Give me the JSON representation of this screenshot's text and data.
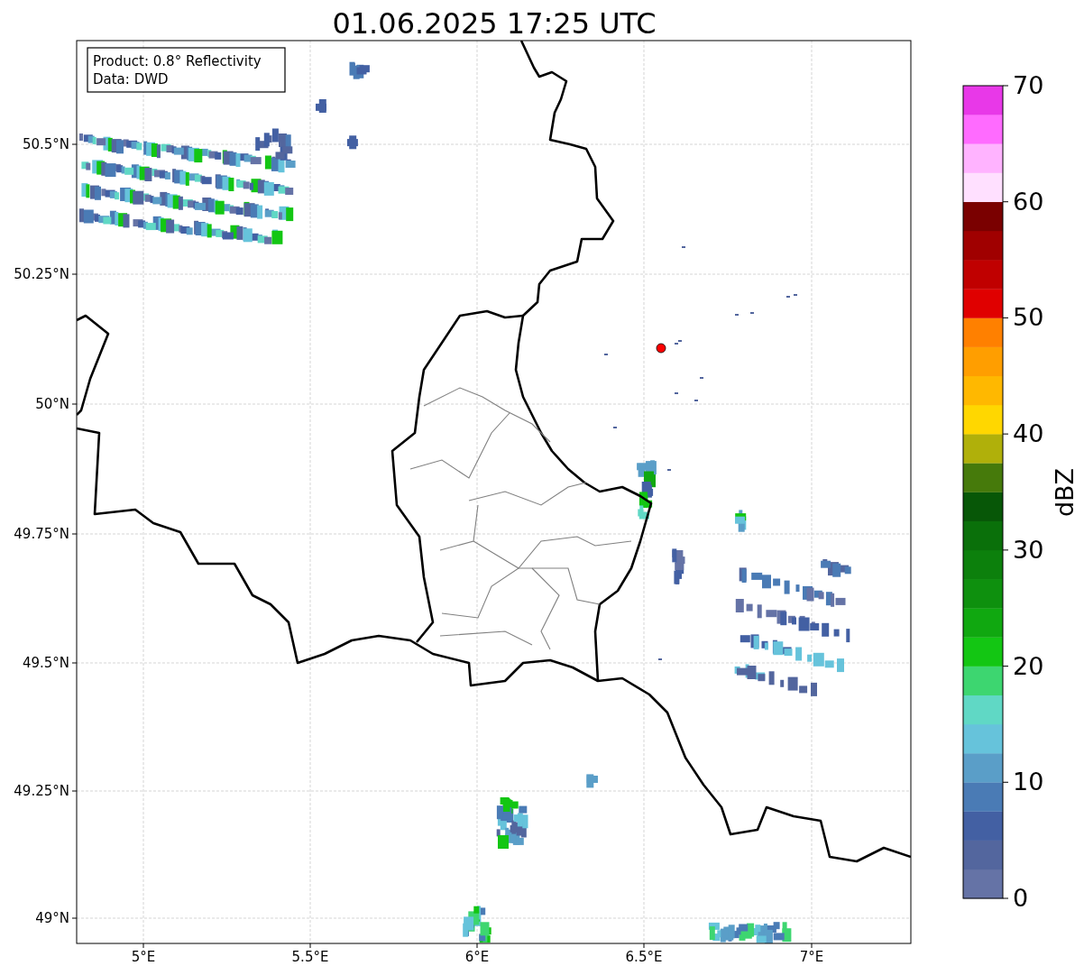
{
  "title": "01.06.2025 17:25 UTC",
  "legend": [
    "Product: 0.8° Reflectivity",
    "Data: DWD"
  ],
  "map": {
    "lon_ticks": [
      "5°E",
      "5.5°E",
      "6°E",
      "6.5°E",
      "7°E"
    ],
    "lat_ticks": [
      "50.5°N",
      "50.25°N",
      "50°N",
      "49.75°N",
      "49.5°N",
      "49.25°N",
      "49°N"
    ]
  },
  "colorbar": {
    "label": "dBZ",
    "ticks": [
      "70",
      "60",
      "50",
      "40",
      "30",
      "20",
      "10",
      "0"
    ],
    "segments": [
      {
        "color": "#6573a6"
      },
      {
        "color": "#53669e"
      },
      {
        "color": "#4360a3"
      },
      {
        "color": "#4a7bb5"
      },
      {
        "color": "#5a9ec8"
      },
      {
        "color": "#66c3db"
      },
      {
        "color": "#60d8c5"
      },
      {
        "color": "#3dd670"
      },
      {
        "color": "#13c613"
      },
      {
        "color": "#10a810"
      },
      {
        "color": "#0e900e"
      },
      {
        "color": "#0c800c"
      },
      {
        "color": "#0a700a"
      },
      {
        "color": "#075707"
      },
      {
        "color": "#467a0b"
      },
      {
        "color": "#b0b00a"
      },
      {
        "color": "#ffd700"
      },
      {
        "color": "#ffb800"
      },
      {
        "color": "#ff9e00"
      },
      {
        "color": "#ff8000"
      },
      {
        "color": "#e00000"
      },
      {
        "color": "#c00000"
      },
      {
        "color": "#a00000"
      },
      {
        "color": "#7a0000"
      },
      {
        "color": "#ffe0ff"
      },
      {
        "color": "#ffb3ff"
      },
      {
        "color": "#ff6bff"
      },
      {
        "color": "#e838e8"
      }
    ]
  }
}
